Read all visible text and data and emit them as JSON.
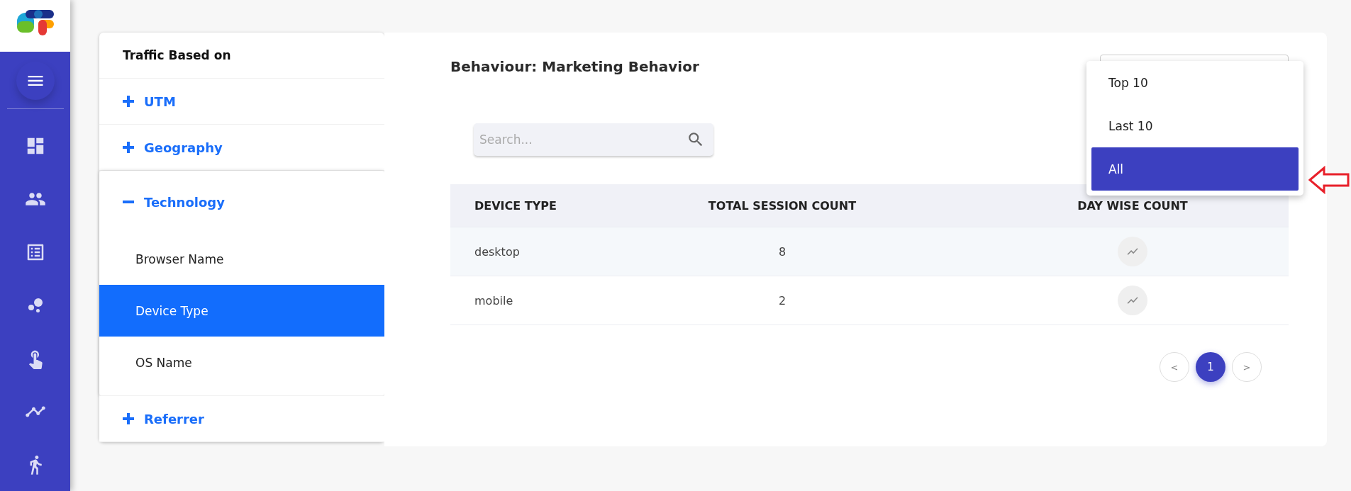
{
  "sidebar": {
    "items": [
      {
        "kind": "menu"
      },
      {
        "kind": "dashboard"
      },
      {
        "kind": "people"
      },
      {
        "kind": "list"
      },
      {
        "kind": "bubbles"
      },
      {
        "kind": "touch"
      },
      {
        "kind": "timeline"
      },
      {
        "kind": "walk"
      }
    ]
  },
  "filter_panel": {
    "title": "Traffic Based on",
    "sections": [
      {
        "label": "UTM",
        "expanded": false
      },
      {
        "label": "Geography",
        "expanded": false
      },
      {
        "label": "Technology",
        "expanded": true,
        "children": [
          {
            "label": "Browser Name",
            "selected": false
          },
          {
            "label": "Device Type",
            "selected": true
          },
          {
            "label": "OS Name",
            "selected": false
          }
        ]
      },
      {
        "label": "Referrer",
        "expanded": false
      }
    ]
  },
  "main": {
    "title": "Behaviour: Marketing Behavior",
    "search": {
      "placeholder": "Search..."
    },
    "dropdown": {
      "options": [
        {
          "label": "Top 10",
          "selected": false
        },
        {
          "label": "Last 10",
          "selected": false
        },
        {
          "label": "All",
          "selected": true
        }
      ]
    },
    "table": {
      "columns": [
        "DEVICE TYPE",
        "TOTAL SESSION COUNT",
        "DAY WISE COUNT"
      ],
      "rows": [
        {
          "device_type": "desktop",
          "total_session_count": "8"
        },
        {
          "device_type": "mobile",
          "total_session_count": "2"
        }
      ]
    },
    "pagination": [
      {
        "kind": "prev",
        "label": "<",
        "selected": false
      },
      {
        "kind": "page",
        "label": "1",
        "selected": true
      },
      {
        "kind": "next",
        "label": ">",
        "selected": false
      }
    ]
  }
}
